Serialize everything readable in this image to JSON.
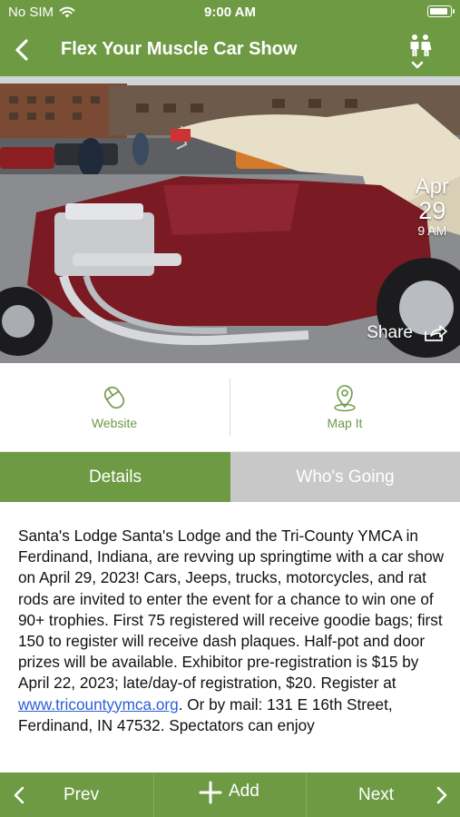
{
  "status_bar": {
    "carrier": "No SIM",
    "time": "9:00 AM"
  },
  "nav": {
    "title": "Flex Your Muscle Car Show"
  },
  "hero": {
    "date_month": "Apr",
    "date_day": "29",
    "date_time": "9 AM",
    "share_label": "Share"
  },
  "actions": {
    "website_label": "Website",
    "map_label": "Map It"
  },
  "tabs": {
    "details_label": "Details",
    "whos_going_label": "Who's Going",
    "active": "Details"
  },
  "description": {
    "text_before_link": "Santa's Lodge Santa's Lodge and the Tri-County YMCA in Ferdinand, Indiana, are revving up springtime with a car show on April 29, 2023! Cars, Jeeps, trucks, motorcycles, and rat rods are invited to enter the event for a chance to win one of 90+ trophies. First 75 registered will receive goodie bags; first 150 to register will receive dash plaques. Half-pot and door prizes will be available. Exhibitor pre-registration is $15 by April 22, 2023; late/day-of registration, $20. Register at ",
    "link_text": "www.tricountyymca.org",
    "text_after_link": ". Or by mail: 131 E 16th Street, Ferdinand, IN 47532. Spectators can enjoy"
  },
  "bottom_bar": {
    "prev_label": "Prev",
    "add_label": "Add",
    "next_label": "Next"
  },
  "colors": {
    "brand_green": "#6e9a44",
    "tab_inactive": "#c8c8c8",
    "link_blue": "#2b5fd6"
  }
}
